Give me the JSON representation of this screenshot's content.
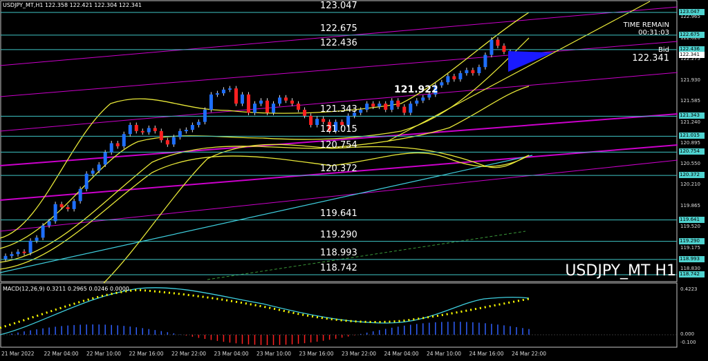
{
  "header": {
    "info": "USDJPY_MT,H1  122.358 122.421 122.304 122.341",
    "time_remain_label": "TIME REMAIN",
    "time_remain_value": "00:31:03",
    "bid_label": "Bid",
    "bid_value": "122.341",
    "symbol_title": "USDJPY_MT H1"
  },
  "macd": {
    "label": "MACD(12,26,9) 0.3211 0.2965 0.0246 0.0000",
    "scale": [
      "0.4223",
      "0.000",
      "-0.100"
    ]
  },
  "horizontal_levels": [
    "123.047",
    "122.675",
    "122.436",
    "121.343",
    "121.015",
    "120.754",
    "120.372",
    "119.641",
    "119.290",
    "118.993",
    "118.742"
  ],
  "annotation": "121.922",
  "price_scale": [
    "122.965",
    "122.620",
    "122.275",
    "121.930",
    "121.585",
    "121.240",
    "120.895",
    "120.550",
    "120.210",
    "119.865",
    "119.520",
    "119.175",
    "118.830"
  ],
  "price_tags": [
    "123.047",
    "122.675",
    "122.436",
    "122.341",
    "121.343",
    "121.015",
    "120.754",
    "120.372",
    "119.641",
    "119.290",
    "118.993",
    "118.742"
  ],
  "time_axis": [
    "21 Mar 2022",
    "22 Mar 04:00",
    "22 Mar 10:00",
    "22 Mar 16:00",
    "22 Mar 22:00",
    "23 Mar 04:00",
    "23 Mar 10:00",
    "23 Mar 16:00",
    "23 Mar 22:00",
    "24 Mar 04:00",
    "24 Mar 10:00",
    "24 Mar 16:00",
    "24 Mar 22:00"
  ],
  "colors": {
    "bull": "#1e6fff",
    "bear": "#ff2020",
    "level_line": "#3fc7c7",
    "channel": "#cc00cc",
    "bands": "#e8e838",
    "signal": "#ffff00",
    "macd_line": "#3fd0e0"
  },
  "chart_data": {
    "type": "candlestick",
    "ylim": [
      118.742,
      123.047
    ],
    "closes": [
      119.05,
      119.08,
      119.12,
      119.1,
      119.3,
      119.35,
      119.55,
      119.62,
      119.9,
      119.85,
      119.82,
      119.95,
      120.15,
      120.4,
      120.45,
      120.55,
      120.75,
      120.9,
      120.85,
      121.05,
      121.2,
      121.1,
      121.08,
      121.15,
      121.1,
      120.95,
      120.88,
      121.0,
      121.1,
      121.12,
      121.2,
      121.25,
      121.45,
      121.7,
      121.72,
      121.78,
      121.8,
      121.55,
      121.7,
      121.4,
      121.55,
      121.6,
      121.4,
      121.55,
      121.65,
      121.6,
      121.55,
      121.45,
      121.35,
      121.2,
      121.3,
      121.25,
      121.1,
      121.25,
      121.2,
      121.35,
      121.4,
      121.45,
      121.55,
      121.5,
      121.55,
      121.45,
      121.6,
      121.5,
      121.4,
      121.55,
      121.6,
      121.65,
      121.7,
      121.85,
      121.9,
      122.0,
      121.95,
      122.05,
      122.1,
      122.05,
      122.15,
      122.35,
      122.6,
      122.5,
      122.4,
      122.35,
      122.32,
      122.34,
      122.341
    ]
  }
}
